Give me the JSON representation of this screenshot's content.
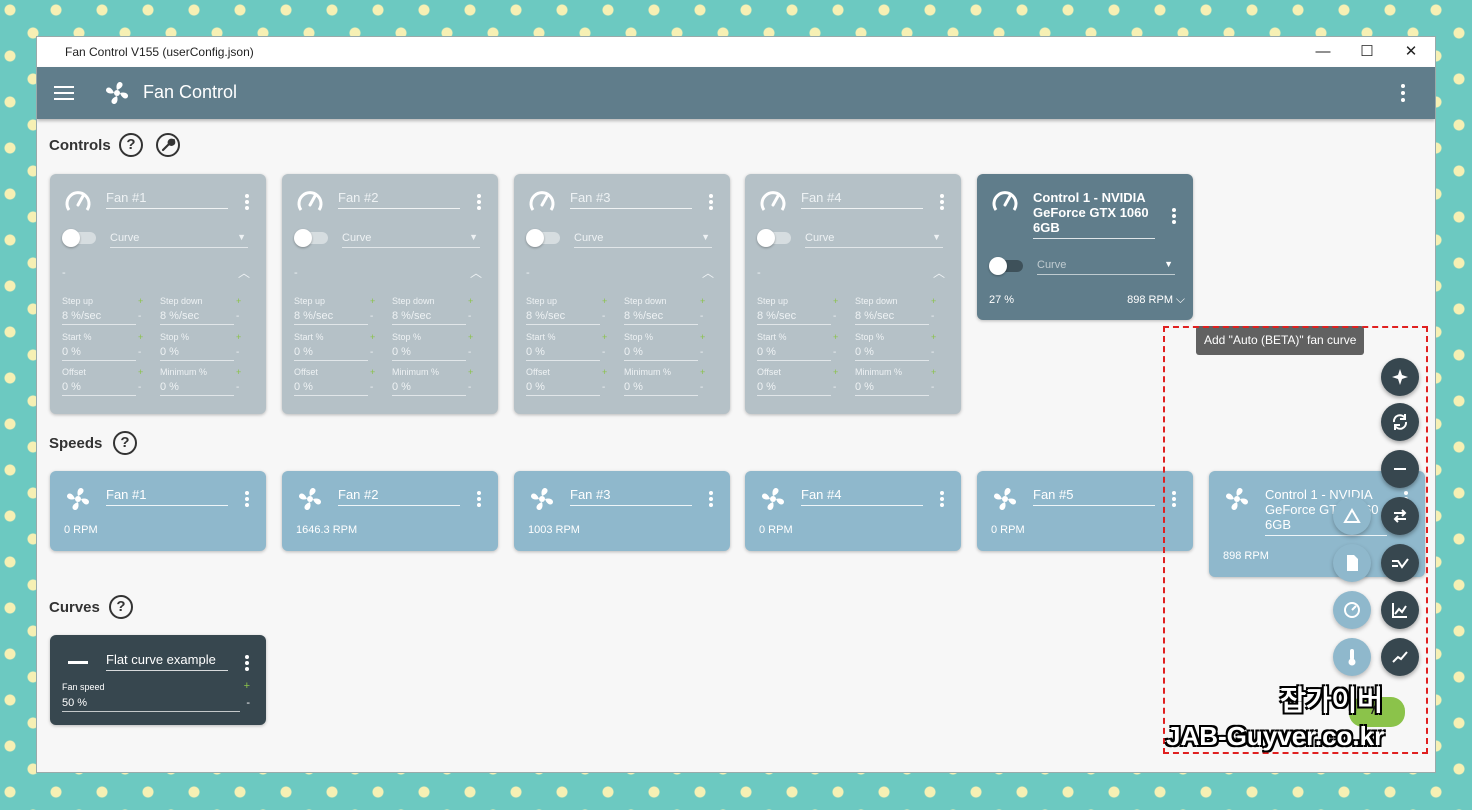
{
  "window": {
    "title": "Fan Control V155 (userConfig.json)",
    "minimize": "—",
    "maximize": "☐",
    "close": "✕"
  },
  "appbar": {
    "title": "Fan Control"
  },
  "sections": {
    "controls": "Controls",
    "speeds": "Speeds",
    "curves": "Curves",
    "help": "?"
  },
  "control_labels": {
    "curve": "Curve",
    "dash": "-",
    "step_up": "Step up",
    "step_down": "Step down",
    "start": "Start %",
    "stop": "Stop %",
    "offset": "Offset",
    "minimum": "Minimum %",
    "plus": "+",
    "minus": "-"
  },
  "controls": [
    {
      "name": "Fan #1",
      "step_up": "8 %/sec",
      "step_down": "8 %/sec",
      "start": "0 %",
      "stop": "0 %",
      "offset": "0 %",
      "minimum": "0 %"
    },
    {
      "name": "Fan #2",
      "step_up": "8 %/sec",
      "step_down": "8 %/sec",
      "start": "0 %",
      "stop": "0 %",
      "offset": "0 %",
      "minimum": "0 %"
    },
    {
      "name": "Fan #3",
      "step_up": "8 %/sec",
      "step_down": "8 %/sec",
      "start": "0 %",
      "stop": "0 %",
      "offset": "0 %",
      "minimum": "0 %"
    },
    {
      "name": "Fan #4",
      "step_up": "8 %/sec",
      "step_down": "8 %/sec",
      "start": "0 %",
      "stop": "0 %",
      "offset": "0 %",
      "minimum": "0 %"
    }
  ],
  "active_control": {
    "name": "Control 1 - NVIDIA GeForce GTX 1060 6GB",
    "curve": "Curve",
    "percent": "27 %",
    "rpm": "898 RPM"
  },
  "speeds": [
    {
      "name": "Fan #1",
      "rpm": "0 RPM"
    },
    {
      "name": "Fan #2",
      "rpm": "1646.3 RPM"
    },
    {
      "name": "Fan #3",
      "rpm": "1003 RPM"
    },
    {
      "name": "Fan #4",
      "rpm": "0 RPM"
    },
    {
      "name": "Fan #5",
      "rpm": "0 RPM"
    },
    {
      "name": "Control 1 - NVIDIA GeForce GTX 1060 6GB",
      "rpm": "898 RPM"
    }
  ],
  "curves": [
    {
      "name": "Flat curve example",
      "label": "Fan speed",
      "value": "50 %",
      "plus": "+",
      "minus": "-"
    }
  ],
  "tooltip": "Add \"Auto (BETA)\" fan curve",
  "watermark": {
    "korean": "잡가이버",
    "url": "JAB-Guyver.co.kr"
  },
  "colors": {
    "appbar": "#607d8b",
    "control_card": "#b5c1c7",
    "active_card": "#607d8b",
    "speed_card": "#8fb8cc",
    "curve_card": "#37474f",
    "accent": "#8bc34a"
  }
}
